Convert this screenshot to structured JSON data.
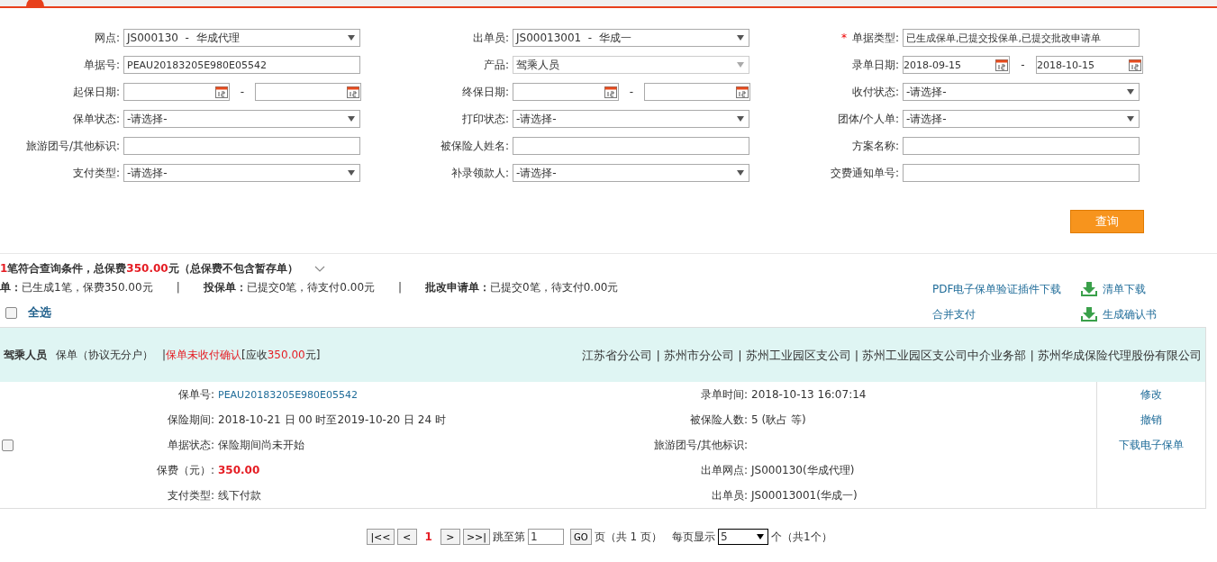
{
  "form": {
    "rows": [
      [
        {
          "label": "网点:",
          "kind": "select",
          "disabled": false,
          "value": "JS000130  -  华成代理"
        },
        {
          "label": "出单员:",
          "kind": "select",
          "disabled": false,
          "value": "JS00013001  -  华成一"
        },
        {
          "label": "单据类型:",
          "kind": "text",
          "required_mark": "*",
          "value": "已生成保单,已提交投保单,已提交批改申请单"
        }
      ],
      [
        {
          "label": "单据号:",
          "kind": "text",
          "value": "PEAU20183205E980E05542"
        },
        {
          "label": "产品:",
          "kind": "select",
          "disabled": true,
          "value": "驾乘人员"
        },
        {
          "label": "录单日期:",
          "kind": "date-range",
          "from": "2018-09-15",
          "to": "2018-10-15",
          "separator": "-"
        }
      ],
      [
        {
          "label": "起保日期:",
          "kind": "date-range",
          "separator": "-"
        },
        {
          "label": "终保日期:",
          "kind": "date-range",
          "separator": "-"
        },
        {
          "label": "收付状态:",
          "kind": "select",
          "disabled": false,
          "value": "-请选择-"
        }
      ],
      [
        {
          "label": "保单状态:",
          "kind": "select",
          "disabled": false,
          "value": "-请选择-"
        },
        {
          "label": "打印状态:",
          "kind": "select",
          "disabled": false,
          "value": "-请选择-"
        },
        {
          "label": "团体/个人单:",
          "kind": "select",
          "disabled": false,
          "value": "-请选择-"
        }
      ],
      [
        {
          "label": "旅游团号/其他标识:",
          "kind": "text"
        },
        {
          "label": "被保险人姓名:",
          "kind": "text"
        },
        {
          "label": "方案名称:",
          "kind": "text"
        }
      ],
      [
        {
          "label": "支付类型:",
          "kind": "select",
          "disabled": false,
          "value": "-请选择-"
        },
        {
          "label": "补录领款人:",
          "kind": "select",
          "disabled": false,
          "value": "-请选择-"
        },
        {
          "label": "交费通知单号:",
          "kind": "text"
        }
      ]
    ],
    "search_button": "查询"
  },
  "summary": {
    "parts": [
      {
        "text": "1",
        "highlight": true
      },
      {
        "text": "笔符合查询条件，总保费",
        "highlight": false
      },
      {
        "text": "350.00",
        "highlight": true
      },
      {
        "text": "元（总保费不包含暂存单）",
        "highlight": false
      }
    ],
    "stats": [
      {
        "label": "单：",
        "value": "已生成1笔，保费350.00元"
      },
      {
        "separator": "|",
        "label": "投保单：",
        "value": "已提交0笔，待支付0.00元"
      },
      {
        "separator": "|",
        "label": "批改申请单：",
        "value": "已提交0笔，待支付0.00元"
      }
    ]
  },
  "links": [
    {
      "text": "PDF电子保单验证插件下载",
      "icon": false
    },
    {
      "text": "清单下载",
      "icon": true
    },
    {
      "text": "合并支付",
      "icon": false
    },
    {
      "text": "生成确认书",
      "icon": true
    }
  ],
  "select_all": {
    "label": "全选",
    "checked": false
  },
  "records": [
    {
      "product": "驾乘人员",
      "type": "保单（协议无分户）",
      "divider": "|",
      "status": "保单未收付确认",
      "due_prefix": "[应收",
      "due_amount": "350.00",
      "due_suffix": "元]",
      "org_path": "江苏省分公司  |  苏州市分公司  |  苏州工业园区支公司  |  苏州工业园区支公司中介业务部  |  苏州华成保险代理股份有限公司",
      "checked": false,
      "details": [
        [
          {
            "label": "保单号:",
            "value": "PEAU20183205E980E05542",
            "kind": "link"
          },
          {
            "label": "录单时间:",
            "value": "2018-10-13 16:07:14",
            "kind": "plain"
          }
        ],
        [
          {
            "label": "保险期间:",
            "value": "2018-10-21 日 00 时至2019-10-20 日 24 时",
            "kind": "plain"
          },
          {
            "label": "被保险人数:",
            "value": "5 (耿占 等)",
            "kind": "plain"
          }
        ],
        [
          {
            "label": "单据状态:",
            "value": "保险期间尚未开始",
            "kind": "plain"
          },
          {
            "label": "旅游团号/其他标识:",
            "kind": "plain"
          }
        ],
        [
          {
            "label": "保费（元）:",
            "value": "350.00",
            "kind": "amount"
          },
          {
            "label": "出单网点:",
            "value": "JS000130(华成代理)",
            "kind": "plain"
          }
        ],
        [
          {
            "label": "支付类型:",
            "value": "线下付款",
            "kind": "plain"
          },
          {
            "label": "出单员:",
            "value": "JS00013001(华成一)",
            "kind": "plain"
          }
        ]
      ],
      "actions": [
        "修改",
        "撤销",
        "下载电子保单"
      ]
    }
  ],
  "pagination": {
    "first": "|<<",
    "prev": "<",
    "current": "1",
    "next": ">",
    "last": ">>|",
    "jump_label": "跳至第",
    "jump_value": "1",
    "go": "GO",
    "pages_text": "页（共 1 页）",
    "per_page_label": "每页显示",
    "per_page": "5",
    "total_text": "个（共1个）"
  }
}
